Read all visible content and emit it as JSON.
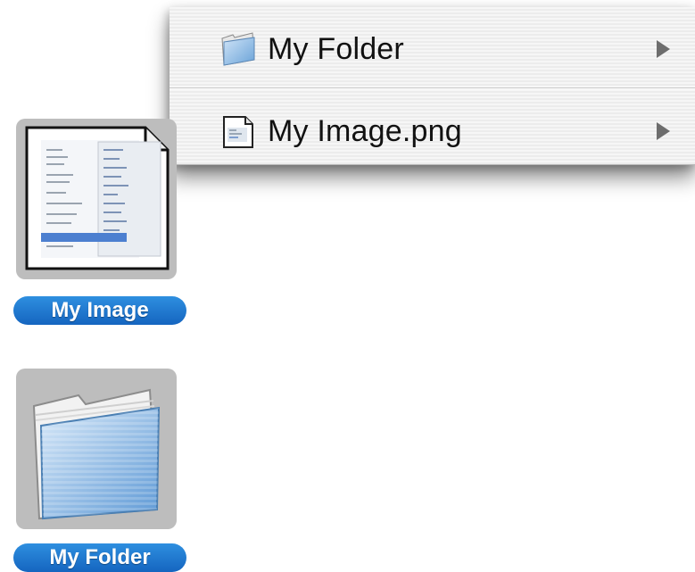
{
  "context_menu": {
    "items": [
      {
        "label": "My Folder",
        "icon": "folder-icon",
        "has_submenu": true
      },
      {
        "label": "My Image.png",
        "icon": "image-file-icon",
        "has_submenu": true
      }
    ]
  },
  "desktop": {
    "icons": [
      {
        "label": "My Image",
        "icon": "image-thumbnail-icon",
        "selected": true
      },
      {
        "label": "My Folder",
        "icon": "folder-icon",
        "selected": true
      }
    ]
  },
  "colors": {
    "selection_label": "#1565c0",
    "icon_highlight": "#bdbdbd",
    "menu_background": "#f1f1f1"
  }
}
